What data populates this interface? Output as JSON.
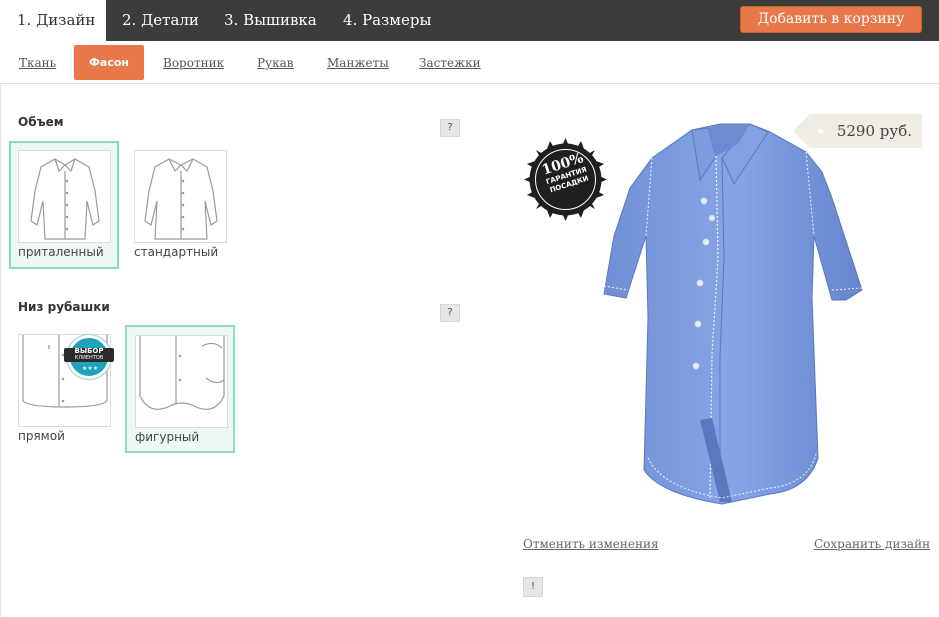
{
  "steps": [
    {
      "label": "1. Дизайн"
    },
    {
      "label": "2. Детали"
    },
    {
      "label": "3. Вышивка"
    },
    {
      "label": "4. Размеры"
    }
  ],
  "cart_button": "Добавить в корзину",
  "subtabs": [
    {
      "label": "Ткань"
    },
    {
      "label": "Фасон"
    },
    {
      "label": "Воротник"
    },
    {
      "label": "Рукав"
    },
    {
      "label": "Манжеты"
    },
    {
      "label": "Застежки"
    }
  ],
  "sections": {
    "volume": {
      "title": "Объем",
      "help": "?",
      "options": [
        {
          "label": "приталенный"
        },
        {
          "label": "стандартный"
        }
      ]
    },
    "bottom": {
      "title": "Низ рубашки",
      "help": "?",
      "options": [
        {
          "label": "прямой"
        },
        {
          "label": "фигурный"
        }
      ],
      "badge_line1": "ВЫБОР",
      "badge_line2": "КЛИЕНТОВ"
    }
  },
  "preview": {
    "price": "5290 руб.",
    "guarantee_big": "100%",
    "guarantee_line1": "ГАРАНТИЯ",
    "guarantee_line2": "ПОСАДКИ",
    "shirt_color": "#7f9fe0",
    "cancel_link": "Отменить изменения",
    "save_link": "Сохранить дизайн",
    "info": "!"
  }
}
